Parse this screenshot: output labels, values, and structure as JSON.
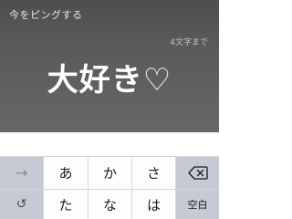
{
  "prompt": {
    "label": "今をピングする",
    "limit": "4文字まで"
  },
  "input": {
    "value": "大好き♡"
  },
  "keyboard": {
    "row1": {
      "next": "→",
      "a": "あ",
      "ka": "か",
      "sa": "さ",
      "backspace_icon": "backspace-icon"
    },
    "row2": {
      "undo": "↺",
      "ta": "た",
      "na": "な",
      "ha": "は",
      "space": "空白"
    }
  },
  "colors": {
    "top_background": "#5a5a5a",
    "keyboard_background": "#d4d6dc",
    "key_light": "#fdfdfd",
    "key_dark": "#c6cad2"
  }
}
